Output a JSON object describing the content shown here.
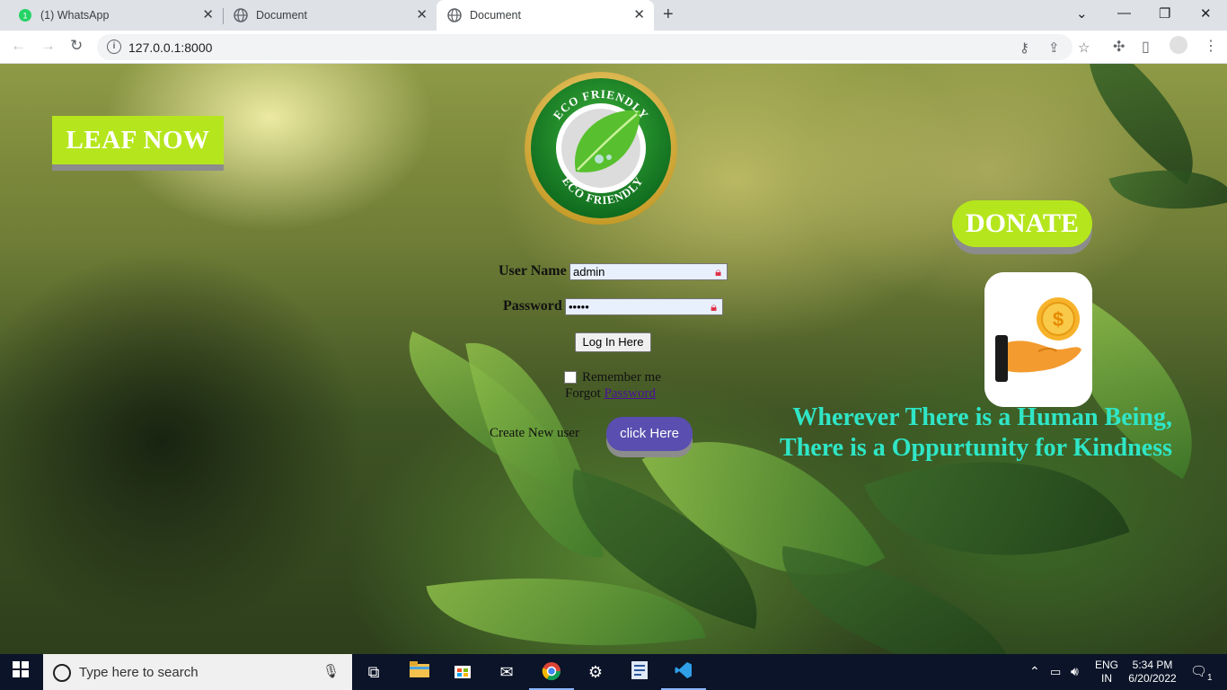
{
  "browser": {
    "tabs": [
      {
        "title": "(1) WhatsApp",
        "badge": "1"
      },
      {
        "title": "Document"
      },
      {
        "title": "Document",
        "active": true
      }
    ],
    "url": "127.0.0.1:8000"
  },
  "page": {
    "brand": "LEAF NOW",
    "logo": {
      "top_text": "ECO FRIENDLY",
      "bottom_text": "ECO FRIENDLY"
    },
    "login": {
      "username_label": "User Name",
      "username_value": "admin",
      "password_label": "Password",
      "password_value": "•••••",
      "login_button": "Log In Here",
      "remember_label": "Remember me",
      "forgot_prefix": "Forgot",
      "forgot_link": "Password",
      "create_label": "Create New user",
      "create_button": "click Here"
    },
    "donate_button": "DONATE",
    "donate_icon_symbol": "$",
    "quote_line1": "Wherever There is a Human Being,",
    "quote_line2": "There is a Oppurtunity for Kindness"
  },
  "taskbar": {
    "search_placeholder": "Type here to search",
    "language": "ENG",
    "region": "IN",
    "time": "5:34 PM",
    "date": "6/20/2022",
    "notification_count": "1"
  },
  "colors": {
    "accent_green": "#b5e61d",
    "quote_color": "#2fe6c7",
    "button_purple": "#5a4eb0"
  }
}
